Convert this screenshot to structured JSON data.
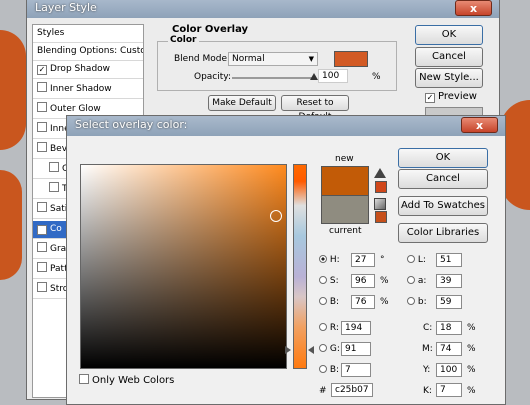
{
  "layer_style": {
    "title": "Layer Style",
    "styles_header": "Styles",
    "blending_options": "Blending Options: Custom",
    "items": [
      {
        "label": "Drop Shadow",
        "checked": true
      },
      {
        "label": "Inner Shadow",
        "checked": false
      },
      {
        "label": "Outer Glow",
        "checked": false
      },
      {
        "label": "Inne",
        "checked": false
      },
      {
        "label": "Beve",
        "checked": false
      },
      {
        "label": "C",
        "checked": false
      },
      {
        "label": "T",
        "checked": false
      },
      {
        "label": "Sati",
        "checked": false
      },
      {
        "label": "Co",
        "checked": true
      },
      {
        "label": "Grad",
        "checked": false
      },
      {
        "label": "Patt",
        "checked": false
      },
      {
        "label": "Stro",
        "checked": false
      }
    ],
    "color_overlay": {
      "title": "Color Overlay",
      "subtitle": "Color",
      "blend_mode_label": "Blend Mode:",
      "blend_mode_value": "Normal",
      "swatch_color": "#d25a24",
      "opacity_label": "Opacity:",
      "opacity_value": "100",
      "opacity_unit": "%",
      "opacity_level": 1.0
    },
    "make_default": "Make Default",
    "reset_default": "Reset to Default",
    "ok": "OK",
    "cancel": "Cancel",
    "new_style": "New Style...",
    "preview": "Preview",
    "preview_checked": true
  },
  "picker": {
    "title": "Select overlay color:",
    "close": "x",
    "ok": "OK",
    "cancel": "Cancel",
    "add_to_swatches": "Add To Swatches",
    "color_libraries": "Color Libraries",
    "new_label": "new",
    "current_label": "current",
    "new_color": "#c25b07",
    "current_color": "#8f8c80",
    "gamut_warning_color": "#d0471a",
    "web_warning_color": "#c64f1a",
    "fields": {
      "H": {
        "value": "27",
        "unit": "°"
      },
      "S": {
        "value": "96",
        "unit": "%"
      },
      "B": {
        "value": "76",
        "unit": "%"
      },
      "R": {
        "value": "194",
        "unit": ""
      },
      "G": {
        "value": "91",
        "unit": ""
      },
      "Bl": {
        "value": "7",
        "unit": ""
      },
      "L": {
        "value": "51",
        "unit": ""
      },
      "a": {
        "value": "39",
        "unit": ""
      },
      "b": {
        "value": "59",
        "unit": ""
      },
      "C": {
        "value": "18",
        "unit": "%"
      },
      "M": {
        "value": "74",
        "unit": "%"
      },
      "Y": {
        "value": "100",
        "unit": "%"
      },
      "K": {
        "value": "7",
        "unit": "%"
      }
    },
    "hex_label": "#",
    "hex_value": "c25b07",
    "only_web_colors": "Only Web Colors",
    "selected_radio": "H"
  }
}
